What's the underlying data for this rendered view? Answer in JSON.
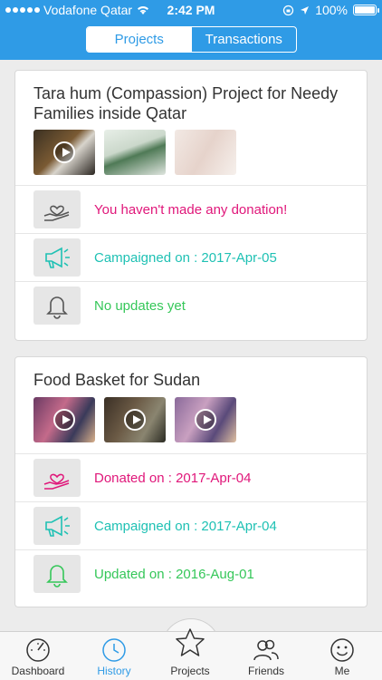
{
  "status_bar": {
    "carrier": "Vodafone Qatar",
    "time": "2:42 PM",
    "battery": "100%"
  },
  "segmented": {
    "projects_label": "Projects",
    "transactions_label": "Transactions",
    "selected": "Projects"
  },
  "projects": [
    {
      "title": "Tara hum (Compassion) Project for Needy Families inside Qatar",
      "media": [
        "video-thumbnail",
        "image-thumbnail",
        "image-thumbnail"
      ],
      "rows": [
        {
          "icon": "heart-hand-icon",
          "text": "You haven't made any donation!",
          "color": "#e0177a"
        },
        {
          "icon": "megaphone-icon",
          "text": "Campaigned on : 2017-Apr-05",
          "color": "#1fc1b4"
        },
        {
          "icon": "bell-icon",
          "text": "No updates yet",
          "color": "#35c759"
        }
      ]
    },
    {
      "title": "Food Basket for Sudan",
      "media": [
        "video-thumbnail",
        "video-thumbnail",
        "video-thumbnail"
      ],
      "rows": [
        {
          "icon": "heart-hand-icon",
          "text": "Donated on : 2017-Apr-04",
          "color": "#e0177a"
        },
        {
          "icon": "megaphone-icon",
          "text": "Campaigned on : 2017-Apr-04",
          "color": "#1fc1b4"
        },
        {
          "icon": "bell-icon",
          "text": "Updated on : 2016-Aug-01",
          "color": "#35c759"
        }
      ]
    }
  ],
  "tabbar": {
    "items": [
      {
        "label": "Dashboard",
        "icon": "gauge-icon"
      },
      {
        "label": "History",
        "icon": "clock-icon"
      },
      {
        "label": "Projects",
        "icon": "star-icon"
      },
      {
        "label": "Friends",
        "icon": "friends-icon"
      },
      {
        "label": "Me",
        "icon": "smiley-icon"
      }
    ],
    "active": "History"
  },
  "colors": {
    "brand": "#2f9be6",
    "donation": "#e0177a",
    "campaign": "#1fc1b4",
    "update": "#35c759"
  }
}
